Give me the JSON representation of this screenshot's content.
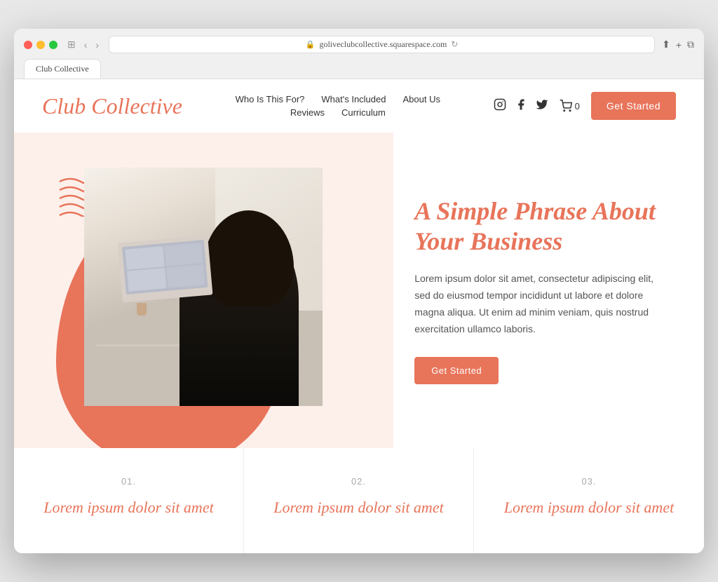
{
  "browser": {
    "url": "goliveclubcollective.squarespace.com",
    "tab_label": "Club Collective"
  },
  "header": {
    "logo": "Club Collective",
    "nav_row1": [
      {
        "id": "who",
        "label": "Who Is This For?"
      },
      {
        "id": "whats-included",
        "label": "What's Included"
      },
      {
        "id": "about",
        "label": "About Us"
      }
    ],
    "nav_row2": [
      {
        "id": "reviews",
        "label": "Reviews"
      },
      {
        "id": "curriculum",
        "label": "Curriculum"
      }
    ],
    "social": [
      "instagram",
      "facebook",
      "twitter"
    ],
    "cart_count": "0",
    "cta_button": "Get Started"
  },
  "hero": {
    "headline": "A Simple Phrase About Your Business",
    "body": "Lorem ipsum dolor sit amet, consectetur adipiscing elit, sed do eiusmod tempor incididunt ut labore et dolore magna aliqua. Ut enim ad minim veniam, quis nostrud exercitation ullamco laboris.",
    "cta_button": "Get Started"
  },
  "features": [
    {
      "number": "01.",
      "title": "Lorem ipsum dolor sit amet"
    },
    {
      "number": "02.",
      "title": "Lorem ipsum dolor sit amet"
    },
    {
      "number": "03.",
      "title": "Lorem ipsum dolor sit amet"
    }
  ]
}
